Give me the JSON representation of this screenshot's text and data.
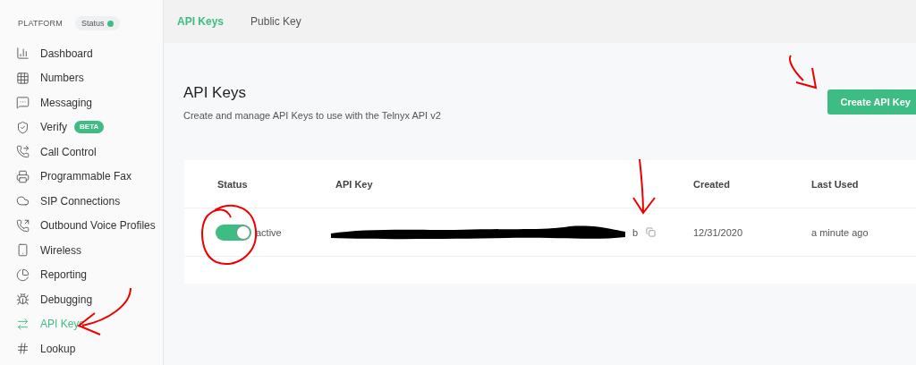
{
  "sidebar": {
    "section": "PLATFORM",
    "status": {
      "label": "Status",
      "color": "#3dbd84"
    },
    "items": [
      {
        "label": "Dashboard",
        "selected": false
      },
      {
        "label": "Numbers",
        "selected": false
      },
      {
        "label": "Messaging",
        "selected": false
      },
      {
        "label": "Verify",
        "selected": false,
        "badge": "BETA"
      },
      {
        "label": "Call Control",
        "selected": false
      },
      {
        "label": "Programmable Fax",
        "selected": false
      },
      {
        "label": "SIP Connections",
        "selected": false
      },
      {
        "label": "Outbound Voice Profiles",
        "selected": false
      },
      {
        "label": "Wireless",
        "selected": false
      },
      {
        "label": "Reporting",
        "selected": false
      },
      {
        "label": "Debugging",
        "selected": false
      },
      {
        "label": "API Keys",
        "selected": true
      },
      {
        "label": "Lookup",
        "selected": false
      }
    ]
  },
  "tabs": [
    {
      "label": "API Keys",
      "selected": true
    },
    {
      "label": "Public Key",
      "selected": false
    }
  ],
  "page": {
    "title": "API Keys",
    "subtitle": "Create and manage API Keys to use with the Telnyx API v2",
    "action": "Create API Key"
  },
  "table": {
    "columns": [
      "Status",
      "API Key",
      "Created",
      "Last Used"
    ],
    "rows": [
      {
        "on": true,
        "status": "active",
        "api_key": "b",
        "created": "12/31/2020",
        "last_used": "a minute ago"
      }
    ]
  }
}
